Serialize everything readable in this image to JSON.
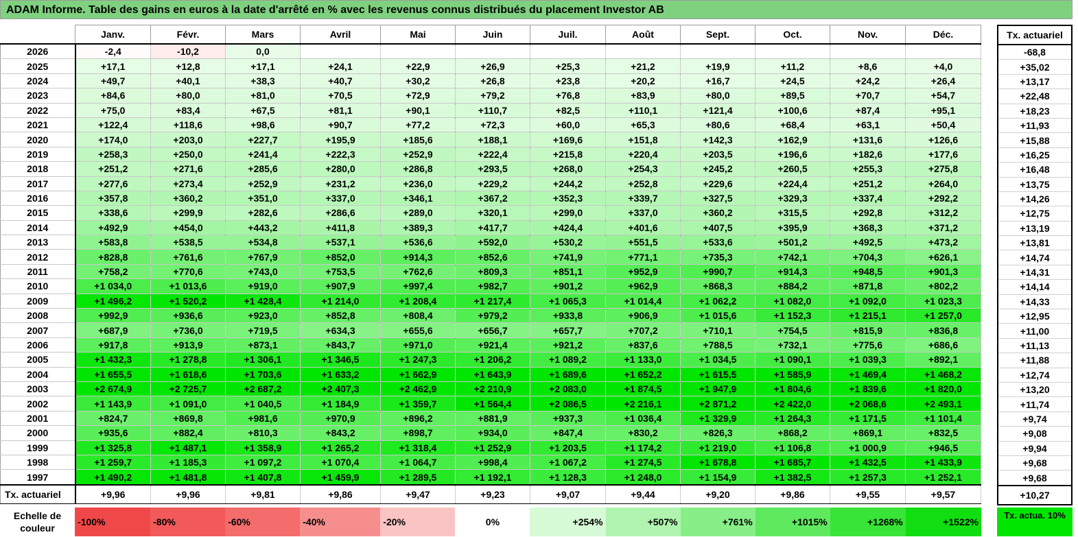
{
  "title": "ADAM Informe. Table des gains en euros à la date d'arrêté en % avec les revenus connus distribués du placement Investor AB",
  "months": [
    "Janv.",
    "Févr.",
    "Mars",
    "Avril",
    "Mai",
    "Juin",
    "Juil.",
    "Août",
    "Sept.",
    "Oct.",
    "Nov.",
    "Déc."
  ],
  "actuariel_header": "Tx. actuariel",
  "rows": [
    {
      "year": "2026",
      "values": [
        "-2,4",
        "-10,2",
        "0,0",
        "",
        "",
        "",
        "",
        "",
        "",
        "",
        "",
        ""
      ],
      "actuariel": "-68,8"
    },
    {
      "year": "2025",
      "values": [
        "+17,1",
        "+12,8",
        "+17,1",
        "+24,1",
        "+22,9",
        "+26,9",
        "+25,3",
        "+21,2",
        "+19,9",
        "+11,2",
        "+8,6",
        "+4,0"
      ],
      "actuariel": "+35,02"
    },
    {
      "year": "2024",
      "values": [
        "+49,7",
        "+40,1",
        "+38,3",
        "+40,7",
        "+30,2",
        "+26,8",
        "+23,8",
        "+20,2",
        "+16,7",
        "+24,5",
        "+24,2",
        "+26,4"
      ],
      "actuariel": "+13,17"
    },
    {
      "year": "2023",
      "values": [
        "+84,6",
        "+80,0",
        "+81,0",
        "+70,5",
        "+72,9",
        "+79,2",
        "+76,8",
        "+83,9",
        "+80,0",
        "+89,5",
        "+70,7",
        "+54,7"
      ],
      "actuariel": "+22,48"
    },
    {
      "year": "2022",
      "values": [
        "+75,0",
        "+83,4",
        "+67,5",
        "+81,1",
        "+90,1",
        "+110,7",
        "+82,5",
        "+110,1",
        "+121,4",
        "+100,6",
        "+87,4",
        "+95,1"
      ],
      "actuariel": "+18,23"
    },
    {
      "year": "2021",
      "values": [
        "+122,4",
        "+118,6",
        "+98,6",
        "+90,7",
        "+77,2",
        "+72,3",
        "+60,0",
        "+65,3",
        "+80,6",
        "+68,4",
        "+63,1",
        "+50,4"
      ],
      "actuariel": "+11,93"
    },
    {
      "year": "2020",
      "values": [
        "+174,0",
        "+203,0",
        "+227,7",
        "+195,9",
        "+185,6",
        "+188,1",
        "+169,6",
        "+151,8",
        "+142,3",
        "+162,9",
        "+131,6",
        "+126,6"
      ],
      "actuariel": "+15,88"
    },
    {
      "year": "2019",
      "values": [
        "+258,3",
        "+250,0",
        "+241,4",
        "+222,3",
        "+252,9",
        "+222,4",
        "+215,8",
        "+220,4",
        "+203,5",
        "+196,6",
        "+182,6",
        "+177,6"
      ],
      "actuariel": "+16,25"
    },
    {
      "year": "2018",
      "values": [
        "+251,2",
        "+271,6",
        "+285,6",
        "+280,0",
        "+286,8",
        "+293,5",
        "+268,0",
        "+254,3",
        "+245,2",
        "+260,5",
        "+255,3",
        "+275,8"
      ],
      "actuariel": "+16,48"
    },
    {
      "year": "2017",
      "values": [
        "+277,6",
        "+273,4",
        "+252,9",
        "+231,2",
        "+236,0",
        "+229,2",
        "+244,2",
        "+252,8",
        "+229,6",
        "+224,4",
        "+251,2",
        "+264,0"
      ],
      "actuariel": "+13,75"
    },
    {
      "year": "2016",
      "values": [
        "+357,8",
        "+360,2",
        "+351,0",
        "+337,0",
        "+346,1",
        "+367,2",
        "+352,3",
        "+339,7",
        "+327,5",
        "+329,3",
        "+337,4",
        "+292,2"
      ],
      "actuariel": "+14,26"
    },
    {
      "year": "2015",
      "values": [
        "+338,6",
        "+299,9",
        "+282,6",
        "+286,6",
        "+289,0",
        "+320,1",
        "+299,0",
        "+337,0",
        "+360,2",
        "+315,5",
        "+292,8",
        "+312,2"
      ],
      "actuariel": "+12,75"
    },
    {
      "year": "2014",
      "values": [
        "+492,9",
        "+454,0",
        "+443,2",
        "+411,8",
        "+389,3",
        "+417,7",
        "+424,4",
        "+401,6",
        "+407,5",
        "+395,9",
        "+368,3",
        "+371,2"
      ],
      "actuariel": "+13,19"
    },
    {
      "year": "2013",
      "values": [
        "+583,8",
        "+538,5",
        "+534,8",
        "+537,1",
        "+536,6",
        "+592,0",
        "+530,2",
        "+551,5",
        "+533,6",
        "+501,2",
        "+492,5",
        "+473,2"
      ],
      "actuariel": "+13,81"
    },
    {
      "year": "2012",
      "values": [
        "+828,8",
        "+761,6",
        "+767,9",
        "+852,0",
        "+914,3",
        "+852,6",
        "+741,9",
        "+771,1",
        "+735,3",
        "+742,1",
        "+704,3",
        "+626,1"
      ],
      "actuariel": "+14,74"
    },
    {
      "year": "2011",
      "values": [
        "+758,2",
        "+770,6",
        "+743,0",
        "+753,5",
        "+762,6",
        "+809,3",
        "+851,1",
        "+952,9",
        "+990,7",
        "+914,3",
        "+948,5",
        "+901,3"
      ],
      "actuariel": "+14,31"
    },
    {
      "year": "2010",
      "values": [
        "+1 034,0",
        "+1 013,6",
        "+919,0",
        "+907,9",
        "+997,4",
        "+982,7",
        "+901,2",
        "+962,9",
        "+868,3",
        "+884,2",
        "+871,8",
        "+802,2"
      ],
      "actuariel": "+14,14"
    },
    {
      "year": "2009",
      "values": [
        "+1 496,2",
        "+1 520,2",
        "+1 428,4",
        "+1 214,0",
        "+1 208,4",
        "+1 217,4",
        "+1 065,3",
        "+1 014,4",
        "+1 062,2",
        "+1 082,0",
        "+1 092,0",
        "+1 023,3"
      ],
      "actuariel": "+14,33"
    },
    {
      "year": "2008",
      "values": [
        "+992,9",
        "+936,6",
        "+923,0",
        "+852,8",
        "+808,4",
        "+979,2",
        "+933,8",
        "+906,9",
        "+1 015,6",
        "+1 152,3",
        "+1 215,1",
        "+1 257,0"
      ],
      "actuariel": "+12,95"
    },
    {
      "year": "2007",
      "values": [
        "+687,9",
        "+736,0",
        "+719,5",
        "+634,3",
        "+655,6",
        "+656,7",
        "+657,7",
        "+707,2",
        "+710,1",
        "+754,5",
        "+815,9",
        "+836,8"
      ],
      "actuariel": "+11,00"
    },
    {
      "year": "2006",
      "values": [
        "+917,8",
        "+913,9",
        "+873,1",
        "+843,7",
        "+971,0",
        "+921,4",
        "+921,2",
        "+837,6",
        "+788,5",
        "+732,1",
        "+775,6",
        "+686,6"
      ],
      "actuariel": "+11,13"
    },
    {
      "year": "2005",
      "values": [
        "+1 432,3",
        "+1 278,8",
        "+1 306,1",
        "+1 346,5",
        "+1 247,3",
        "+1 206,2",
        "+1 089,2",
        "+1 133,0",
        "+1 034,5",
        "+1 090,1",
        "+1 039,3",
        "+892,1"
      ],
      "actuariel": "+11,88"
    },
    {
      "year": "2004",
      "values": [
        "+1 655,5",
        "+1 618,6",
        "+1 703,6",
        "+1 633,2",
        "+1 662,9",
        "+1 643,9",
        "+1 689,6",
        "+1 652,2",
        "+1 615,5",
        "+1 585,9",
        "+1 469,4",
        "+1 468,2"
      ],
      "actuariel": "+12,74"
    },
    {
      "year": "2003",
      "values": [
        "+2 674,9",
        "+2 725,7",
        "+2 687,2",
        "+2 407,3",
        "+2 462,9",
        "+2 210,9",
        "+2 083,0",
        "+1 874,5",
        "+1 947,9",
        "+1 804,6",
        "+1 839,6",
        "+1 820,0"
      ],
      "actuariel": "+13,20"
    },
    {
      "year": "2002",
      "values": [
        "+1 143,9",
        "+1 091,0",
        "+1 040,5",
        "+1 184,9",
        "+1 359,7",
        "+1 564,4",
        "+2 086,5",
        "+2 216,1",
        "+2 871,2",
        "+2 422,0",
        "+2 068,6",
        "+2 493,1"
      ],
      "actuariel": "+11,74"
    },
    {
      "year": "2001",
      "values": [
        "+824,7",
        "+869,8",
        "+981,6",
        "+970,9",
        "+896,2",
        "+881,9",
        "+937,3",
        "+1 036,4",
        "+1 329,9",
        "+1 264,3",
        "+1 171,5",
        "+1 101,4"
      ],
      "actuariel": "+9,74"
    },
    {
      "year": "2000",
      "values": [
        "+935,6",
        "+882,4",
        "+810,3",
        "+843,2",
        "+898,7",
        "+934,0",
        "+847,4",
        "+830,2",
        "+826,3",
        "+868,2",
        "+869,1",
        "+832,5"
      ],
      "actuariel": "+9,08"
    },
    {
      "year": "1999",
      "values": [
        "+1 325,8",
        "+1 487,1",
        "+1 358,9",
        "+1 265,2",
        "+1 318,4",
        "+1 252,9",
        "+1 203,5",
        "+1 174,2",
        "+1 219,0",
        "+1 106,8",
        "+1 000,9",
        "+946,5"
      ],
      "actuariel": "+9,94"
    },
    {
      "year": "1998",
      "values": [
        "+1 259,7",
        "+1 185,3",
        "+1 097,2",
        "+1 070,4",
        "+1 064,7",
        "+998,4",
        "+1 067,2",
        "+1 274,5",
        "+1 678,8",
        "+1 685,7",
        "+1 432,5",
        "+1 433,9"
      ],
      "actuariel": "+9,68"
    },
    {
      "year": "1997",
      "values": [
        "+1 490,2",
        "+1 481,8",
        "+1 407,8",
        "+1 459,9",
        "+1 289,5",
        "+1 192,1",
        "+1 128,3",
        "+1 248,0",
        "+1 154,9",
        "+1 382,5",
        "+1 257,3",
        "+1 252,1"
      ],
      "actuariel": "+9,68"
    }
  ],
  "footer": {
    "label": "Tx. actuariel",
    "values": [
      "+9,96",
      "+9,96",
      "+9,81",
      "+9,86",
      "+9,47",
      "+9,23",
      "+9,07",
      "+9,44",
      "+9,20",
      "+9,86",
      "+9,55",
      "+9,57"
    ],
    "actuariel": "+10,27"
  },
  "scale": {
    "label": "Echelle de couleur",
    "items": [
      {
        "label": "-100%",
        "color": "#f04848",
        "kind": "neg"
      },
      {
        "label": "-80%",
        "color": "#f25a5a",
        "kind": "neg"
      },
      {
        "label": "-60%",
        "color": "#f46c6c",
        "kind": "neg"
      },
      {
        "label": "-40%",
        "color": "#f78e8e",
        "kind": "neg"
      },
      {
        "label": "-20%",
        "color": "#fbc4c4",
        "kind": "neg"
      },
      {
        "label": "0%",
        "color": "#ffffff",
        "kind": "zero"
      },
      {
        "label": "+254%",
        "color": "#d7fad7",
        "kind": "pos"
      },
      {
        "label": "+507%",
        "color": "#b0f4b0",
        "kind": "pos"
      },
      {
        "label": "+761%",
        "color": "#88ef88",
        "kind": "pos"
      },
      {
        "label": "+1015%",
        "color": "#5fe95f",
        "kind": "pos"
      },
      {
        "label": "+1268%",
        "color": "#37e437",
        "kind": "pos"
      },
      {
        "label": "+1522%",
        "color": "#10de10",
        "kind": "pos"
      }
    ],
    "actua_label": "Tx. actua. 10%",
    "actua_color": "#00e600"
  }
}
